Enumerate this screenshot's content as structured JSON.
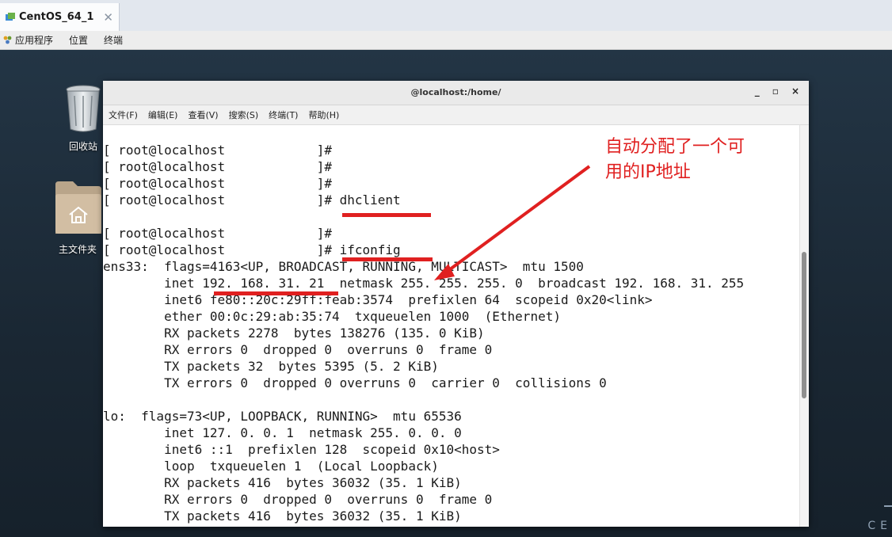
{
  "vm_tab": {
    "title": "CentOS_64_1",
    "close": "✕"
  },
  "gnome_bar": {
    "apps": "应用程序",
    "places": "位置",
    "terminal": "终端"
  },
  "desktop": {
    "trash_label": "回收站",
    "home_label": "主文件夹",
    "brand_fragment": "CE"
  },
  "terminal": {
    "title": "@localhost:/home/",
    "controls": {
      "minimize": "_",
      "maximize": "▫",
      "close": "×"
    },
    "menu": [
      "文件(F)",
      "编辑(E)",
      "查看(V)",
      "搜索(S)",
      "终端(T)",
      "帮助(H)"
    ],
    "lines": [
      "[ root@localhost            ]#",
      "[ root@localhost            ]#",
      "[ root@localhost            ]#",
      "[ root@localhost            ]# dhclient",
      "",
      "[ root@localhost            ]#",
      "[ root@localhost            ]# ifconfig",
      "ens33:  flags=4163<UP, BROADCAST, RUNNING, MULTICAST>  mtu 1500",
      "        inet 192. 168. 31. 21  netmask 255. 255. 255. 0  broadcast 192. 168. 31. 255",
      "        inet6 fe80::20c:29ff:feab:3574  prefixlen 64  scopeid 0x20<link>",
      "        ether 00:0c:29:ab:35:74  txqueuelen 1000  (Ethernet)",
      "        RX packets 2278  bytes 138276 (135. 0 KiB)",
      "        RX errors 0  dropped 0  overruns 0  frame 0",
      "        TX packets 32  bytes 5395 (5. 2 KiB)",
      "        TX errors 0  dropped 0 overruns 0  carrier 0  collisions 0",
      "",
      "lo:  flags=73<UP, LOOPBACK, RUNNING>  mtu 65536",
      "        inet 127. 0. 0. 1  netmask 255. 0. 0. 0",
      "        inet6 ::1  prefixlen 128  scopeid 0x10<host>",
      "        loop  txqueuelen 1  (Local Loopback)",
      "        RX packets 416  bytes 36032 (35. 1 KiB)",
      "        RX errors 0  dropped 0  overruns 0  frame 0",
      "        TX packets 416  bytes 36032 (35. 1 KiB)"
    ]
  },
  "annotation": {
    "text_line1": "自动分配了一个可",
    "text_line2": "用的IP地址",
    "color": "#e02020"
  }
}
